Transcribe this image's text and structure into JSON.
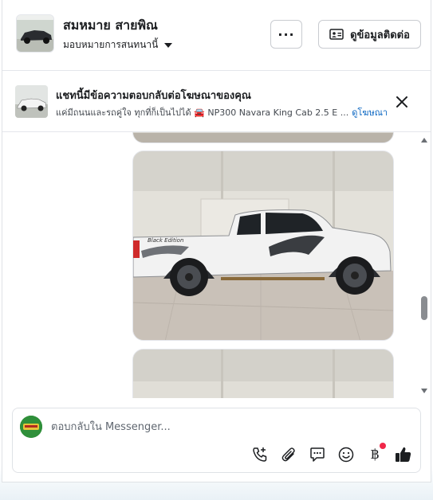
{
  "header": {
    "name": "สมหมาย สายพิณ",
    "assign_label": "มอบหมายการสนทนานี้",
    "more_label": "···",
    "contact_label": "ดูข้อมูลติดต่อ"
  },
  "ad_banner": {
    "title": "แชทนี้มีข้อความตอบกลับต่อโฆษณาของคุณ",
    "subtitle": "แค่มีถนนและรถคู่ใจ ทุกที่ก็เป็นไปได้ 🚘 NP300 Navara King Cab 2.5 E ...",
    "link_label": "ดูโฆษณา"
  },
  "messages": {
    "photo_caption": "Black Edition"
  },
  "composer": {
    "placeholder": "ตอบกลับใน Messenger..."
  },
  "icons": {
    "more": "ellipsis-icon",
    "contact": "contact-card-icon",
    "close": "close-icon",
    "call": "phone-plus-icon",
    "attach": "paperclip-icon",
    "saved_reply": "chat-bubble-icon",
    "emoji": "smiley-icon",
    "payment": "baht-icon",
    "like": "thumbs-up-icon"
  },
  "colors": {
    "accent": "#0a66c2",
    "like": "#1c1e21",
    "notification_dot": "#f02849",
    "truck": "#f2f2f2"
  }
}
